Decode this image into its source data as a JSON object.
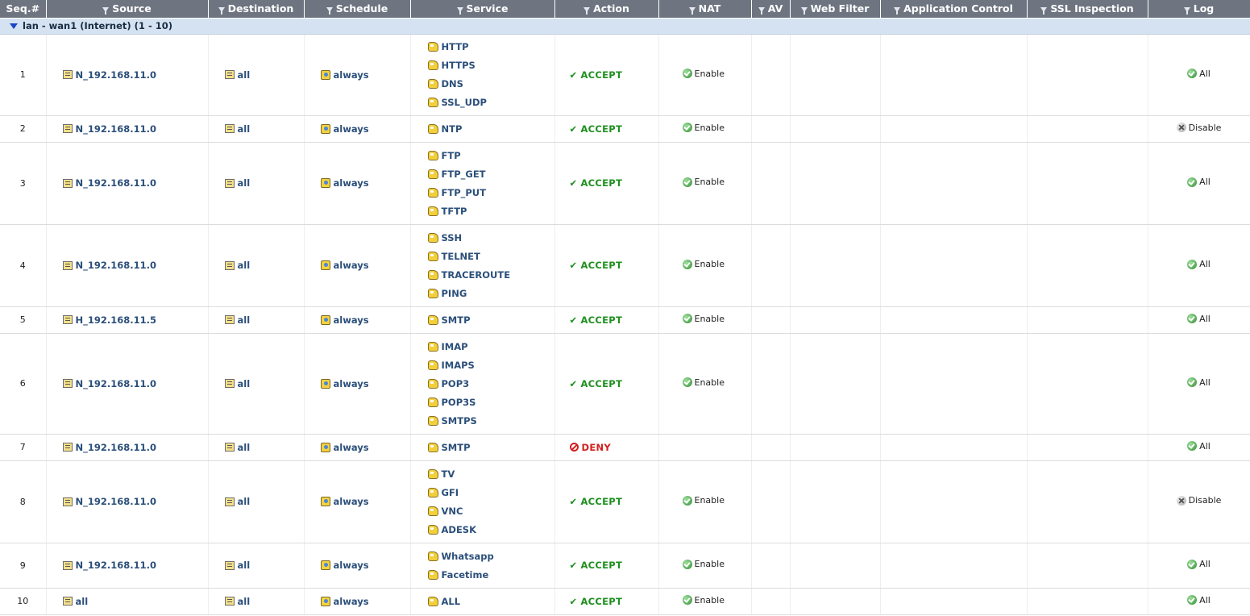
{
  "columns": {
    "seq": "Seq.#",
    "source": "Source",
    "destination": "Destination",
    "schedule": "Schedule",
    "service": "Service",
    "action": "Action",
    "nat": "NAT",
    "av": "AV",
    "web_filter": "Web Filter",
    "application_control": "Application Control",
    "ssl_inspection": "SSL Inspection",
    "log": "Log"
  },
  "section": {
    "label": "lan - wan1 (Internet) (1 - 10)"
  },
  "icons": {
    "filter": "funnel-filter-icon",
    "address": "address-object-icon",
    "schedule": "schedule-icon",
    "service": "service-object-icon",
    "accept": "check-icon",
    "deny": "deny-circle-icon",
    "enabled": "green-check-circle-icon",
    "disabled": "gray-x-circle-icon"
  },
  "colors": {
    "header_bg": "#6e7581",
    "section_bg": "#d5e2f2",
    "accept": "#1f8f1f",
    "deny": "#d42020",
    "object_text": "#2b4f7a"
  },
  "policies": [
    {
      "seq": "1",
      "source": "N_192.168.11.0",
      "destination": "all",
      "schedule": "always",
      "services": [
        "HTTP",
        "HTTPS",
        "DNS",
        "SSL_UDP"
      ],
      "action": "ACCEPT",
      "nat": "Enable",
      "log": "All"
    },
    {
      "seq": "2",
      "source": "N_192.168.11.0",
      "destination": "all",
      "schedule": "always",
      "services": [
        "NTP"
      ],
      "action": "ACCEPT",
      "nat": "Enable",
      "log": "Disable"
    },
    {
      "seq": "3",
      "source": "N_192.168.11.0",
      "destination": "all",
      "schedule": "always",
      "services": [
        "FTP",
        "FTP_GET",
        "FTP_PUT",
        "TFTP"
      ],
      "action": "ACCEPT",
      "nat": "Enable",
      "log": "All"
    },
    {
      "seq": "4",
      "source": "N_192.168.11.0",
      "destination": "all",
      "schedule": "always",
      "services": [
        "SSH",
        "TELNET",
        "TRACEROUTE",
        "PING"
      ],
      "action": "ACCEPT",
      "nat": "Enable",
      "log": "All"
    },
    {
      "seq": "5",
      "source": "H_192.168.11.5",
      "destination": "all",
      "schedule": "always",
      "services": [
        "SMTP"
      ],
      "action": "ACCEPT",
      "nat": "Enable",
      "log": "All"
    },
    {
      "seq": "6",
      "source": "N_192.168.11.0",
      "destination": "all",
      "schedule": "always",
      "services": [
        "IMAP",
        "IMAPS",
        "POP3",
        "POP3S",
        "SMTPS"
      ],
      "action": "ACCEPT",
      "nat": "Enable",
      "log": "All"
    },
    {
      "seq": "7",
      "source": "N_192.168.11.0",
      "destination": "all",
      "schedule": "always",
      "services": [
        "SMTP"
      ],
      "action": "DENY",
      "nat": "",
      "log": "All"
    },
    {
      "seq": "8",
      "source": "N_192.168.11.0",
      "destination": "all",
      "schedule": "always",
      "services": [
        "TV",
        "GFI",
        "VNC",
        "ADESK"
      ],
      "action": "ACCEPT",
      "nat": "Enable",
      "log": "Disable"
    },
    {
      "seq": "9",
      "source": "N_192.168.11.0",
      "destination": "all",
      "schedule": "always",
      "services": [
        "Whatsapp",
        "Facetime"
      ],
      "action": "ACCEPT",
      "nat": "Enable",
      "log": "All"
    },
    {
      "seq": "10",
      "source": "all",
      "destination": "all",
      "schedule": "always",
      "services": [
        "ALL"
      ],
      "action": "ACCEPT",
      "nat": "Enable",
      "log": "All"
    }
  ]
}
